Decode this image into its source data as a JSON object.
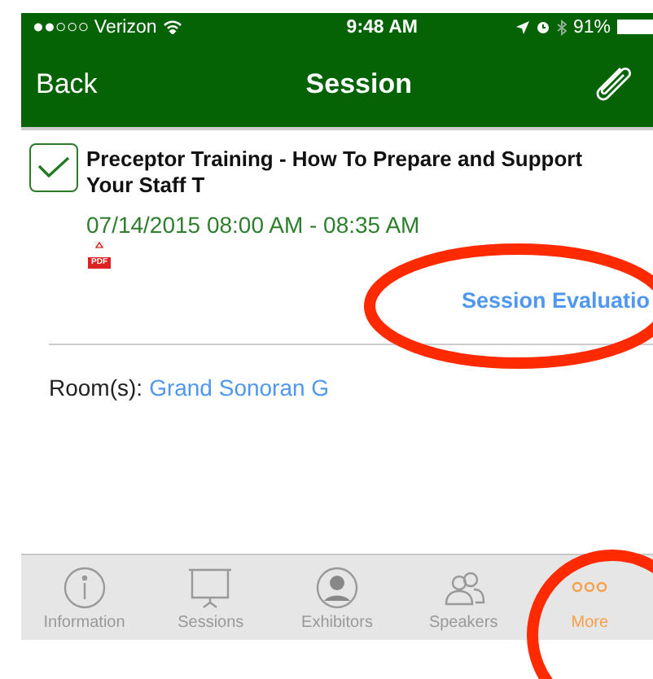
{
  "status_bar": {
    "carrier": "●●○○○ Verizon",
    "time": "9:48 AM",
    "battery": "91%"
  },
  "nav_bar": {
    "back": "Back",
    "title": "Session"
  },
  "session": {
    "checked": true,
    "title": "Preceptor Training - How To Prepare and Support Your Staff T",
    "time": "07/14/2015 08:00 AM - 08:35 AM",
    "attachment": "PDF",
    "evaluation_link": "Session Evaluatio",
    "room_label": "Room(s):",
    "room": "Grand Sonoran G"
  },
  "tabs": [
    {
      "label": "Information",
      "selected": false
    },
    {
      "label": "Sessions",
      "selected": false
    },
    {
      "label": "Exhibitors",
      "selected": false
    },
    {
      "label": "Speakers",
      "selected": false
    },
    {
      "label": "More",
      "selected": true
    }
  ]
}
